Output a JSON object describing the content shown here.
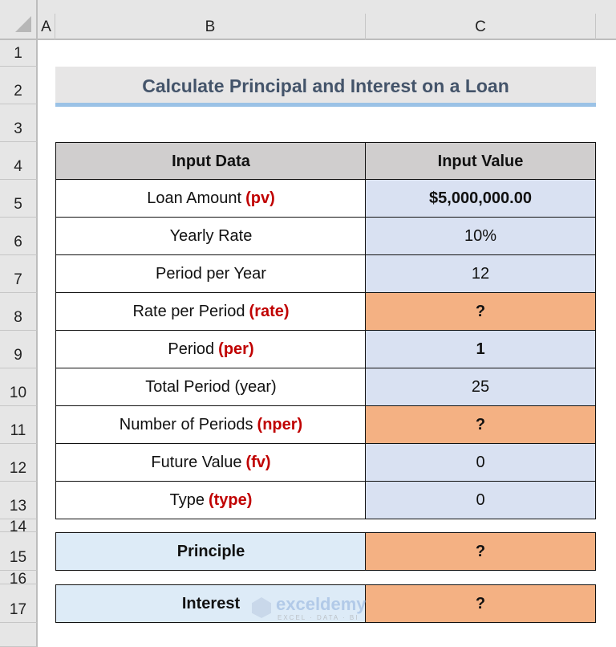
{
  "columns": [
    "A",
    "B",
    "C"
  ],
  "rows": [
    "1",
    "2",
    "3",
    "4",
    "5",
    "6",
    "7",
    "8",
    "9",
    "10",
    "11",
    "12",
    "13",
    "14",
    "15",
    "16",
    "17"
  ],
  "title": "Calculate Principal and Interest on a Loan",
  "table": {
    "headers": [
      "Input Data",
      "Input Value"
    ],
    "rows": [
      {
        "label": "Loan Amount",
        "arg": "(pv)",
        "value": "$5,000,000.00",
        "style": "bold"
      },
      {
        "label": "Yearly Rate",
        "arg": "",
        "value": "10%",
        "style": "normal"
      },
      {
        "label": "Period per Year",
        "arg": "",
        "value": "12",
        "style": "normal"
      },
      {
        "label": "Rate per Period",
        "arg": "(rate)",
        "value": "?",
        "style": "result"
      },
      {
        "label": "Period",
        "arg": "(per)",
        "value": "1",
        "style": "bold"
      },
      {
        "label": "Total Period (year)",
        "arg": "",
        "value": "25",
        "style": "normal"
      },
      {
        "label": "Number of Periods",
        "arg": "(nper)",
        "value": "?",
        "style": "result"
      },
      {
        "label": "Future Value",
        "arg": "(fv)",
        "value": "0",
        "style": "normal"
      },
      {
        "label": "Type",
        "arg": "(type)",
        "value": "0",
        "style": "normal"
      }
    ]
  },
  "results": [
    {
      "label": "Principle",
      "value": "?"
    },
    {
      "label": "Interest",
      "value": "?"
    }
  ],
  "watermark": {
    "brand": "exceldemy",
    "tagline": "EXCEL · DATA · BI"
  },
  "colors": {
    "header_gray": "#d0cece",
    "value_blue": "#d9e1f2",
    "result_orange": "#f4b183",
    "label_blue": "#ddebf7",
    "arg_red": "#c00000",
    "title_text": "#44546a"
  }
}
